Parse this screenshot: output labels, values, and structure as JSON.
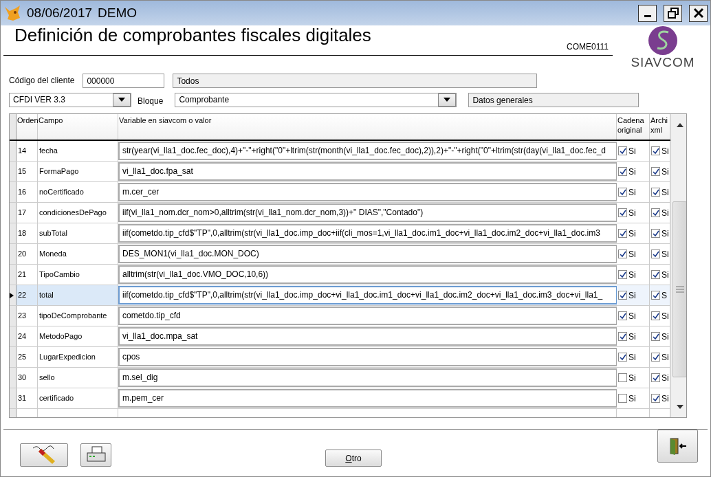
{
  "window": {
    "date": "08/06/2017",
    "mode": "DEMO"
  },
  "header": {
    "title": "Definición de comprobantes fiscales digitales",
    "code": "COME0111",
    "logo_text": "SIAVCOM"
  },
  "filters": {
    "client_label": "Código del cliente",
    "client_code": "000000",
    "client_name": "Todos",
    "version": "CFDI VER 3.3",
    "block_label": "Bloque",
    "block": "Comprobante",
    "section": "Datos generales"
  },
  "table": {
    "columns": [
      "Orden",
      "Campo",
      "Variable en siavcom o valor",
      [
        "Cadena",
        "original"
      ],
      [
        "Archi",
        "xml"
      ]
    ],
    "rows": [
      {
        "orden": "14",
        "campo": "fecha",
        "valor": "str(year(vi_lla1_doc.fec_doc),4)+\"-\"+right(\"0\"+ltrim(str(month(vi_lla1_doc.fec_doc),2)),2)+\"-\"+right(\"0\"+ltrim(str(day(vi_lla1_doc.fec_d",
        "cadena": true,
        "cadena_label": "Si",
        "xml": true,
        "xml_label": "Si",
        "selected": false
      },
      {
        "orden": "15",
        "campo": "FormaPago",
        "valor": "vi_lla1_doc.fpa_sat",
        "cadena": true,
        "cadena_label": "Si",
        "xml": true,
        "xml_label": "Si",
        "selected": false
      },
      {
        "orden": "16",
        "campo": "noCertificado",
        "valor": "m.cer_cer",
        "cadena": true,
        "cadena_label": "Si",
        "xml": true,
        "xml_label": "Si",
        "selected": false
      },
      {
        "orden": "17",
        "campo": "condicionesDePago",
        "valor": "iif(vi_lla1_nom.dcr_nom>0,alltrim(str(vi_lla1_nom.dcr_nom,3))+\" DIAS\",\"Contado\")",
        "cadena": true,
        "cadena_label": "Si",
        "xml": true,
        "xml_label": "Si",
        "selected": false
      },
      {
        "orden": "18",
        "campo": "subTotal",
        "valor": "iif(cometdo.tip_cfd$\"TP\",0,alltrim(str(vi_lla1_doc.imp_doc+iif(cli_mos=1,vi_lla1_doc.im1_doc+vi_lla1_doc.im2_doc+vi_lla1_doc.im3",
        "cadena": true,
        "cadena_label": "Si",
        "xml": true,
        "xml_label": "Si",
        "selected": false
      },
      {
        "orden": "20",
        "campo": "Moneda",
        "valor": "DES_MON1(vi_lla1_doc.MON_DOC)",
        "cadena": true,
        "cadena_label": "Si",
        "xml": true,
        "xml_label": "Si",
        "selected": false
      },
      {
        "orden": "21",
        "campo": "TipoCambio",
        "valor": "alltrim(str(vi_lla1_doc.VMO_DOC,10,6))",
        "cadena": true,
        "cadena_label": "Si",
        "xml": true,
        "xml_label": "Si",
        "selected": false
      },
      {
        "orden": "22",
        "campo": "total",
        "valor": "iif(cometdo.tip_cfd$\"TP\",0,alltrim(str(vi_lla1_doc.imp_doc+vi_lla1_doc.im1_doc+vi_lla1_doc.im2_doc+vi_lla1_doc.im3_doc+vi_lla1_",
        "cadena": true,
        "cadena_label": "Si",
        "xml": true,
        "xml_label": "S",
        "selected": true
      },
      {
        "orden": "23",
        "campo": "tipoDeComprobante",
        "valor": "cometdo.tip_cfd",
        "cadena": true,
        "cadena_label": "Si",
        "xml": true,
        "xml_label": "Si",
        "selected": false
      },
      {
        "orden": "24",
        "campo": "MetodoPago",
        "valor": "vi_lla1_doc.mpa_sat",
        "cadena": true,
        "cadena_label": "Si",
        "xml": true,
        "xml_label": "Si",
        "selected": false
      },
      {
        "orden": "25",
        "campo": "LugarExpedicion",
        "valor": "cpos",
        "cadena": true,
        "cadena_label": "Si",
        "xml": true,
        "xml_label": "Si",
        "selected": false
      },
      {
        "orden": "30",
        "campo": "sello",
        "valor": "m.sel_dig",
        "cadena": false,
        "cadena_label": "Si",
        "xml": true,
        "xml_label": "Si",
        "selected": false
      },
      {
        "orden": "31",
        "campo": "certificado",
        "valor": "m.pem_cer",
        "cadena": false,
        "cadena_label": "Si",
        "xml": true,
        "xml_label": "Si",
        "selected": false
      }
    ]
  },
  "buttons": {
    "other": "Otro"
  }
}
